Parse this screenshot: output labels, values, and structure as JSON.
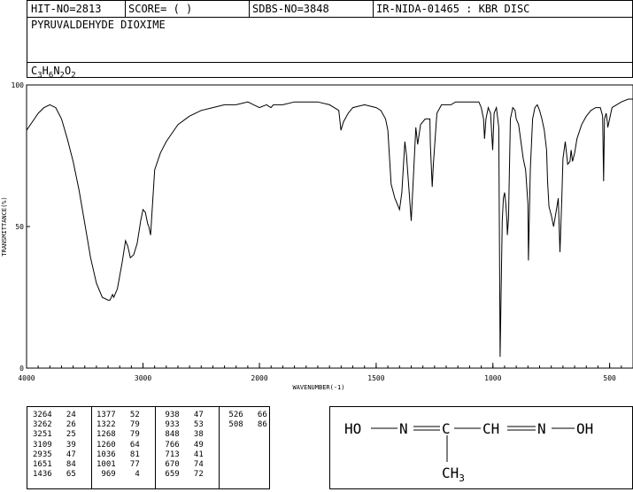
{
  "header": {
    "hit_no": "HIT-NO=2813",
    "score": "SCORE=  (   )",
    "sdbs_no": "SDBS-NO=3848",
    "ir_info": "IR-NIDA-01465 : KBR DISC",
    "compound_name": "PYRUVALDEHYDE DIOXIME",
    "formula": {
      "c": "C",
      "c_n": "3",
      "h": "H",
      "h_n": "6",
      "n": "N",
      "n_n": "2",
      "o": "O",
      "o_n": "2"
    }
  },
  "chart_data": {
    "type": "line",
    "xlabel": "WAVENUMBER(-1)",
    "ylabel": "TRANSMITTANCE(%)",
    "xlim": [
      4000,
      400
    ],
    "ylim": [
      0,
      100
    ],
    "x_ticks": [
      "4000",
      "3000",
      "2000",
      "1500",
      "1000",
      "500"
    ],
    "y_ticks": [
      "100",
      "50",
      "0"
    ],
    "series": [
      {
        "x": [
          4000,
          3950,
          3900,
          3850,
          3800,
          3750,
          3700,
          3650,
          3600,
          3550,
          3500,
          3450,
          3400,
          3350,
          3300,
          3284,
          3262,
          3251,
          3220,
          3180,
          3150,
          3130,
          3109,
          3080,
          3050,
          3020,
          3000,
          2980,
          2960,
          2950,
          2935,
          2900,
          2850,
          2800,
          2750,
          2700,
          2600,
          2500,
          2400,
          2300,
          2200,
          2100,
          2050,
          2000,
          1970,
          1951,
          1940,
          1900,
          1850,
          1800,
          1750,
          1700,
          1680,
          1660,
          1651,
          1640,
          1620,
          1600,
          1550,
          1500,
          1480,
          1460,
          1450,
          1436,
          1420,
          1400,
          1390,
          1377,
          1370,
          1350,
          1330,
          1322,
          1310,
          1290,
          1270,
          1268,
          1260,
          1255,
          1240,
          1220,
          1200,
          1180,
          1160,
          1140,
          1120,
          1100,
          1080,
          1060,
          1050,
          1040,
          1036,
          1030,
          1020,
          1010,
          1001,
          995,
          985,
          975,
          969,
          960,
          955,
          950,
          945,
          940,
          938,
          933,
          925,
          915,
          905,
          900,
          890,
          880,
          870,
          860,
          850,
          848,
          840,
          830,
          820,
          810,
          800,
          790,
          780,
          770,
          766,
          760,
          750,
          740,
          730,
          720,
          713,
          705,
          700,
          690,
          680,
          670,
          665,
          659,
          650,
          640,
          620,
          600,
          580,
          560,
          540,
          530,
          526,
          522,
          515,
          510,
          508,
          500,
          490,
          470,
          450,
          420,
          400
        ],
        "values": [
          84,
          87,
          90,
          92,
          93,
          92,
          88,
          81,
          73,
          63,
          51,
          39,
          30,
          25,
          24,
          24,
          26,
          25,
          28,
          37,
          45,
          43,
          39,
          40,
          44,
          52,
          56,
          55,
          51,
          50,
          47,
          70,
          76,
          80,
          83,
          86,
          89,
          91,
          92,
          93,
          93,
          94,
          93,
          92,
          93,
          92,
          93,
          93,
          94,
          94,
          94,
          93,
          92,
          91,
          84,
          87,
          90,
          92,
          93,
          92,
          91,
          88,
          84,
          65,
          60,
          56,
          62,
          80,
          75,
          52,
          85,
          79,
          86,
          88,
          88,
          79,
          64,
          72,
          90,
          93,
          93,
          93,
          94,
          94,
          94,
          94,
          94,
          94,
          92,
          88,
          81,
          88,
          92,
          90,
          77,
          90,
          92,
          85,
          4,
          52,
          60,
          62,
          58,
          52,
          47,
          53,
          88,
          92,
          91,
          88,
          86,
          80,
          74,
          70,
          58,
          38,
          70,
          88,
          92,
          93,
          91,
          88,
          84,
          77,
          66,
          57,
          54,
          50,
          55,
          60,
          41,
          60,
          74,
          80,
          72,
          73,
          77,
          73,
          76,
          81,
          86,
          89,
          91,
          92,
          92,
          89,
          66,
          88,
          90,
          87,
          85,
          88,
          92,
          93,
          94,
          95,
          95
        ]
      }
    ],
    "peaks": [
      [
        "3264",
        "24"
      ],
      [
        "3262",
        "26"
      ],
      [
        "3251",
        "25"
      ],
      [
        "3109",
        "39"
      ],
      [
        "2935",
        "47"
      ],
      [
        "1651",
        "84"
      ],
      [
        "1436",
        "65"
      ],
      [
        "1377",
        "52"
      ],
      [
        "1322",
        "79"
      ],
      [
        "1268",
        "79"
      ],
      [
        "1260",
        "64"
      ],
      [
        "1036",
        "81"
      ],
      [
        "1001",
        "77"
      ],
      [
        "969",
        "4"
      ],
      [
        "938",
        "47"
      ],
      [
        "933",
        "53"
      ],
      [
        "848",
        "38"
      ],
      [
        "766",
        "49"
      ],
      [
        "713",
        "41"
      ],
      [
        "670",
        "74"
      ],
      [
        "659",
        "72"
      ],
      [
        "526",
        "66"
      ],
      [
        "508",
        "86"
      ]
    ]
  },
  "structure": {
    "ho_1": "HO",
    "n_1": "N",
    "c_1": "C",
    "ch": "CH",
    "n_2": "N",
    "oh": "OH",
    "ch3": "CH",
    "ch3_sub": "3"
  }
}
